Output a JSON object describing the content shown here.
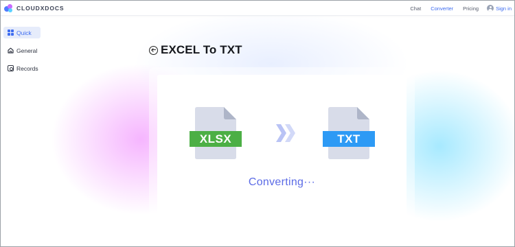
{
  "brand": {
    "name": "CLOUDXDOCS"
  },
  "nav": {
    "items": [
      {
        "label": "Chat",
        "active": false
      },
      {
        "label": "Converter",
        "active": true
      },
      {
        "label": "Pricing",
        "active": false
      }
    ],
    "signin_label": "Sign in"
  },
  "sidebar": {
    "items": [
      {
        "label": "Quick",
        "icon": "grid-icon",
        "active": true
      },
      {
        "label": "General",
        "icon": "home-icon",
        "active": false
      },
      {
        "label": "Records",
        "icon": "records-icon",
        "active": false
      }
    ]
  },
  "main": {
    "title": "EXCEL To TXT",
    "source_format": "XLSX",
    "target_format": "TXT",
    "status": "Converting···"
  },
  "colors": {
    "accent": "#3d6cf0",
    "xlsx_badge": "#4caf45",
    "txt_badge": "#2d9af5",
    "status_text": "#5b6be6"
  }
}
